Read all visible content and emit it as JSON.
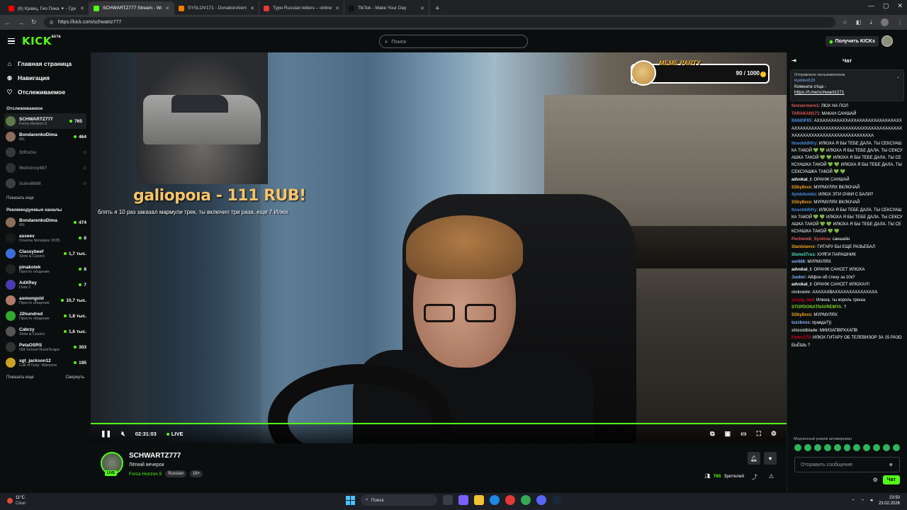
{
  "browser": {
    "tabs": [
      {
        "title": "(6) Кравц, Гио Пика ✦ - Где пр",
        "favicon": "#ff0000",
        "active": false
      },
      {
        "title": "SCHWARTZ777 Stream - Watch",
        "favicon": "#53fc18",
        "active": true
      },
      {
        "title": "SYSLOV171 - DonationAlerts",
        "favicon": "#f57c00",
        "active": false
      },
      {
        "title": "Type Russian letters – online R",
        "favicon": "#e53935",
        "active": false
      },
      {
        "title": "TikTok - Make Your Day",
        "favicon": "#111111",
        "active": false
      }
    ],
    "url": "https://kick.com/schwartz777"
  },
  "header": {
    "logo": "KICK",
    "logo_beta": "BETA",
    "search_placeholder": "Поиск",
    "get_kicks": "Получить KICKs"
  },
  "sidebar": {
    "nav": [
      {
        "label": "Главная страница",
        "icon": "home-icon"
      },
      {
        "label": "Навигация",
        "icon": "compass-icon"
      },
      {
        "label": "Отслеживаемое",
        "icon": "heart-icon"
      }
    ],
    "following_title": "Отслеживаемое",
    "following": [
      {
        "name": "SCHWARTZ777",
        "category": "Forza Horizon 5",
        "viewers": "765",
        "live": true,
        "color": "#5d7a4a"
      },
      {
        "name": "BondarenkoDima",
        "category": "IRL",
        "viewers": "464",
        "live": true,
        "color": "#8a6d5a"
      },
      {
        "name": "StRoGo",
        "category": "",
        "viewers": "",
        "live": false,
        "color": "#777"
      },
      {
        "name": "Mellstroy987",
        "category": "",
        "viewers": "",
        "live": false,
        "color": "#666"
      },
      {
        "name": "Subo8686",
        "category": "",
        "viewers": "",
        "live": false,
        "color": "#888"
      }
    ],
    "show_more": "Показать еще",
    "recommended_title": "Рекомендуемые каналы",
    "recommended": [
      {
        "name": "BondarenkoDima",
        "category": "IRL",
        "viewers": "474",
        "color": "#8a6d5a"
      },
      {
        "name": "asseev",
        "category": "Cinema Simulator 2025",
        "viewers": "8",
        "color": "#1a1a1a"
      },
      {
        "name": "Classybeef",
        "category": "Slots & Casino",
        "viewers": "1,7 тыс.",
        "color": "#3a6fd8"
      },
      {
        "name": "pinakotek",
        "category": "Просто общение",
        "viewers": "8",
        "color": "#222"
      },
      {
        "name": "AdXRey",
        "category": "Dota 2",
        "viewers": "7",
        "color": "#4a3bb0"
      },
      {
        "name": "asmongold",
        "category": "Просто общение",
        "viewers": "10,7 тыс.",
        "color": "#b07a6a"
      },
      {
        "name": "J2hundred",
        "category": "Просто общение",
        "viewers": "1,8 тыс.",
        "color": "#2faa2f"
      },
      {
        "name": "Cabrzy",
        "category": "Slots & Casino",
        "viewers": "1,6 тыс.",
        "color": "#555"
      },
      {
        "name": "PetaOSRS",
        "category": "Old School RuneScape",
        "viewers": "303",
        "color": "#333"
      },
      {
        "name": "sgt_jackson12",
        "category": "Call of Duty: Warzone",
        "viewers": "195",
        "color": "#c9a227"
      }
    ],
    "show_more2": "Показать еще",
    "collapse": "Свернуть"
  },
  "player": {
    "donation_title": "galiopoıa - 111 RUB!",
    "donation_message": "блять я 10 раз заказал мармули трек, ты включил три раза, еще 7 Илюх",
    "meme_title": "MEME PARTY",
    "meme_count": "90 / 1000",
    "time": "02:31:03",
    "live_label": "LIVE",
    "progress": 1.0
  },
  "stream": {
    "name": "SCHWARTZ777",
    "title": "Лёгкий вечерок",
    "category": "Forza Horizon 5",
    "tags": [
      "Russian",
      "18+"
    ],
    "live_badge": "LIVE",
    "viewers": "765",
    "viewers_label": "Зрителей"
  },
  "chat": {
    "title": "Чат",
    "pinned_by": "Отправлено пользователем",
    "pinned_user": "loydokol123",
    "pinned_text": "Комната отца -",
    "pinned_link": "https://t.me/schwartz271",
    "messages": [
      {
        "user": "forevermore1",
        "color": "#e05a5a",
        "text": "ЛЮХ НА ПОЛ"
      },
      {
        "user": "TARAKAN171",
        "color": "#e05a5a",
        "text": "МАКАН САНШАЙ"
      },
      {
        "user": "B6680P85",
        "color": "#4a90e2",
        "text": "АХХАХАХАХАХХАХХАХАХАХХАХАХАХАХХАХХАХАХАХАХАХАХХАХАХАХАХАХХАХАХАХАХАХАХХАХАХАХХАХАХАХАХАХАХАХАХАХАХА"
      },
      {
        "user": "ttosotddhfry",
        "color": "#4a90e2",
        "text": "ИЛЮХА Я БЫ ТЕБЕ ДАЛА. ТЫ СЕКСУАШКА ТАКОЙ 💚 💚 ИЛЮХА Я БЫ ТЕБЕ ДАЛА. ТЫ СЕКСУАШКА ТАКОЙ 💚 💚 ИЛЮХА Я БЫ ТЕБЕ ДАЛА. ТЫ СЕКСУАШКА ТАКОЙ 💚 💚 ИЛЮХА Я БЫ ТЕБЕ ДАЛА. ТЫ СЕКСУАШКА ТАКОЙ 💚 💚"
      },
      {
        "user": "advokat_t",
        "color": "#ffffff",
        "text": "ОРАНЖ САНШАЙ"
      },
      {
        "user": "SSky8xxx",
        "color": "#f5a623",
        "text": "МУРМУЛЯХ ВКЛЮЧАЙ"
      },
      {
        "user": "4ymb4umbz",
        "color": "#4a90e2",
        "text": "ИЛЮХ ЭТИ ОЧКИ С БАЛИ?"
      },
      {
        "user": "SSky8xxx",
        "color": "#f5a623",
        "text": "МУРМУЛЯХ ВКЛЮЧАЙ"
      },
      {
        "user": "ttosotddhfry",
        "color": "#4a90e2",
        "text": "ИЛЮХА Я БЫ ТЕБЕ ДАЛА. ТЫ СЕКСУАШКА ТАКОЙ 💚 💚 ИЛЮХА Я БЫ ТЕБЕ ДАЛА. ТЫ СЕКСУАШКА ТАКОЙ 💚 💚 ИЛЮХА Я БЫ ТЕБЕ ДАЛА. ТЫ СЕКСУАШКА ТАКОЙ 💚 💚"
      },
      {
        "user": "Pecheneb_Syslova",
        "color": "#e05a5a",
        "text": "саншайн"
      },
      {
        "user": "Stanislavvx",
        "color": "#f5a623",
        "text": "ГИТАРУ БЫ ЕЩЕ РАЗЬЕБАЛ"
      },
      {
        "user": "Stone37rus",
        "color": "#50e3c2",
        "text": "ХУЯГИ ПАРАШНИК"
      },
      {
        "user": "ser666",
        "color": "#8cb4ff",
        "text": "МУРМУЛЯХ"
      },
      {
        "user": "advokat_t",
        "color": "#ffffff",
        "text": "ОРАНЖ САНСЕТ ИЛЮХА"
      },
      {
        "user": "Juuker",
        "color": "#8cb4ff",
        "text": "Айфон об стену за 10к?"
      },
      {
        "user": "advokat_t",
        "color": "#ffffff",
        "text": "ОРАНЖ САНСЕТ ИЛЮХА!!!!"
      },
      {
        "user": "nickneim",
        "color": "#c6cacd",
        "text": "АХАХАХВАХХАХАХАХАХАХАХА"
      },
      {
        "user": "young_dali",
        "color": "#d0021b",
        "text": "Илюха, ты король треша"
      },
      {
        "user": "STOPDONATNAVREMYA",
        "color": "#7ed321",
        "text": "?"
      },
      {
        "user": "SSky8xxx",
        "color": "#f5a623",
        "text": "МУРМУЛЯХ"
      },
      {
        "user": "tuzzboss",
        "color": "#8cb4ff",
        "text": "правда?))"
      },
      {
        "user": "shizoidblade",
        "color": "#c6cacd",
        "text": "МИИЗАПВРХХАПВ"
      },
      {
        "user": "Fedor272",
        "color": "#d0021b",
        "text": "ИЛЮХ ГИТАРУ ОБ ТЕЛЕВИЗОР ЗА 15 РАЗОБЬЁШЬ ?"
      }
    ],
    "slow_mode": "Медленный режим активирован",
    "input_placeholder": "Отправить сообщение",
    "send": "Чат"
  },
  "taskbar": {
    "temp": "11°C",
    "weather": "Clear",
    "search": "Поиск",
    "time": "23:50",
    "date": "23.02.2026"
  }
}
